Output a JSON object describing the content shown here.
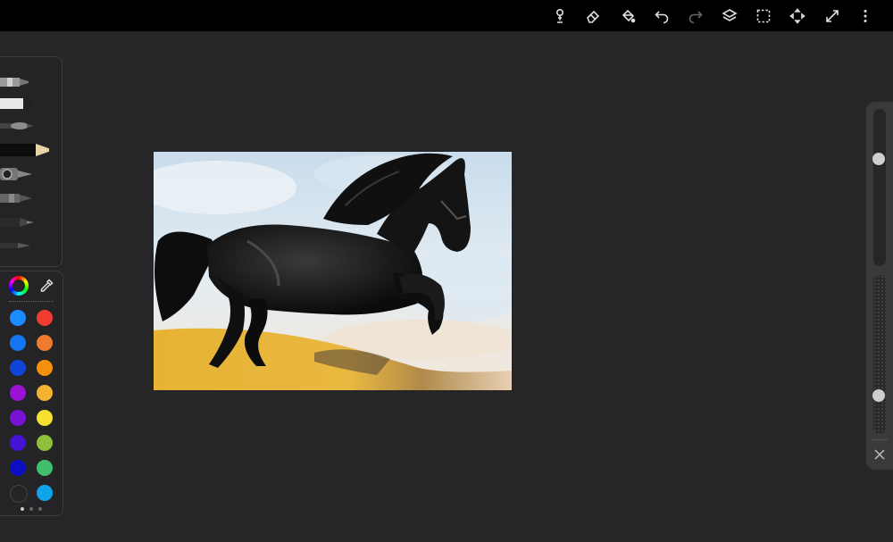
{
  "toolbar": {
    "buttons": [
      {
        "name": "brush-settings",
        "icon": "brush-settings-icon"
      },
      {
        "name": "eraser",
        "icon": "eraser-icon"
      },
      {
        "name": "fill",
        "icon": "paint-bucket-icon"
      },
      {
        "name": "undo",
        "icon": "undo-icon"
      },
      {
        "name": "redo",
        "icon": "redo-icon",
        "disabled": true
      },
      {
        "name": "layers",
        "icon": "layers-icon"
      },
      {
        "name": "selection",
        "icon": "selection-icon"
      },
      {
        "name": "transform",
        "icon": "transform-icon"
      },
      {
        "name": "fullscreen",
        "icon": "fullscreen-icon"
      },
      {
        "name": "more",
        "icon": "more-vertical-icon"
      }
    ]
  },
  "brushes": [
    {
      "name": "airbrush",
      "icon": "airbrush-icon"
    },
    {
      "name": "marker",
      "icon": "marker-icon"
    },
    {
      "name": "soft-brush",
      "icon": "soft-brush-icon"
    },
    {
      "name": "pencil",
      "icon": "pencil-icon",
      "selected": true
    },
    {
      "name": "blender",
      "icon": "blender-icon"
    },
    {
      "name": "pen",
      "icon": "pen-icon"
    },
    {
      "name": "ink-pen",
      "icon": "ink-pen-icon"
    },
    {
      "name": "fine-liner",
      "icon": "fine-liner-icon"
    }
  ],
  "colors": {
    "left": [
      "#1a8cff",
      "#1476f2",
      "#0f44d6",
      "#9b12d6",
      "#7a12d6",
      "#4612d6",
      "#0d0dc4",
      "#242426"
    ],
    "right": [
      "#f23c32",
      "#f07a2e",
      "#f5900c",
      "#f3b22f",
      "#f5e22e",
      "#8fbf3c",
      "#3fbf6a",
      "#0fa3ec"
    ]
  },
  "palette_pages": {
    "count": 3,
    "active": 0
  },
  "sliders": {
    "brush_size": 0.3,
    "opacity": 0.78
  }
}
